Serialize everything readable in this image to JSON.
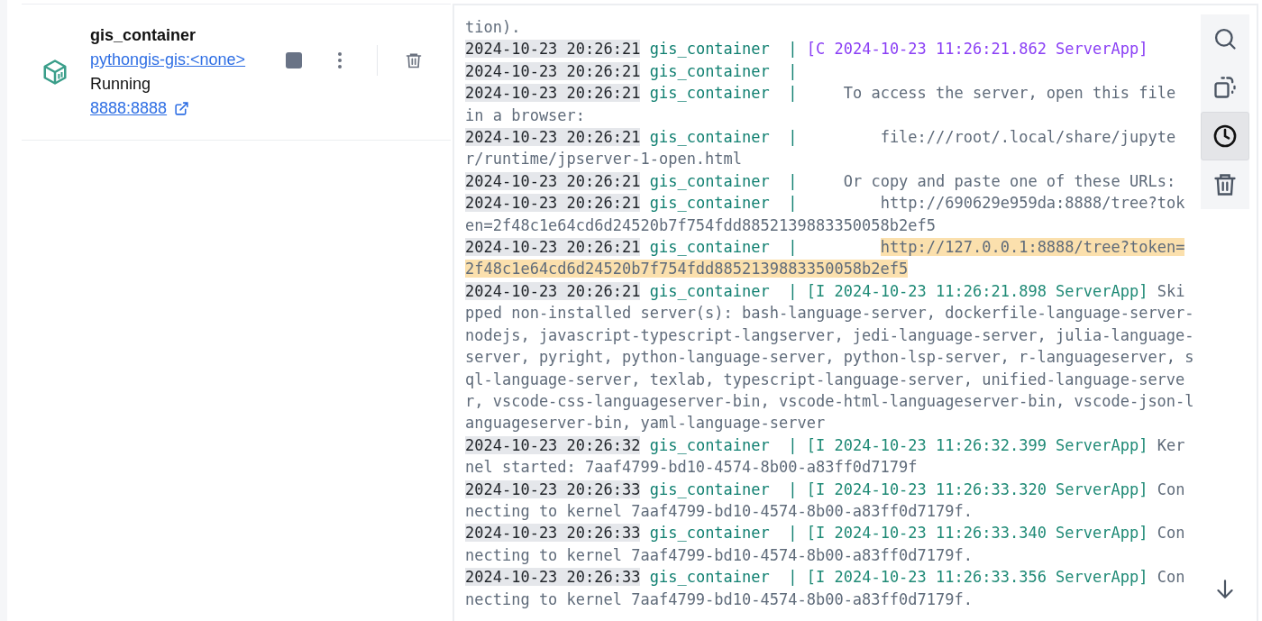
{
  "container": {
    "name": "gis_container",
    "image": "pythongis-gis:<none>",
    "status": "Running",
    "port": "8888:8888"
  },
  "log": {
    "fragment": "tion).",
    "entries": [
      {
        "timestamp": "2024-10-23 20:26:21",
        "container": "gis_container",
        "separator": "|",
        "prefix": "[C 2024-10-23 11:26:21.862 ServerApp]",
        "color": "#8a3ff5"
      },
      {
        "timestamp": "2024-10-23 20:26:21",
        "container": "gis_container",
        "separator": "|"
      },
      {
        "timestamp": "2024-10-23 20:26:21",
        "container": "gis_container",
        "separator": "|",
        "message": "    To access the server, open this file in a browser:"
      },
      {
        "timestamp": "2024-10-23 20:26:21",
        "container": "gis_container",
        "separator": "|",
        "message": "        file:///root/.local/share/jupyter/runtime/jpserver-1-open.html"
      },
      {
        "timestamp": "2024-10-23 20:26:21",
        "container": "gis_container",
        "separator": "|",
        "message": "    Or copy and paste one of these URLs:"
      },
      {
        "timestamp": "2024-10-23 20:26:21",
        "container": "gis_container",
        "separator": "|",
        "message": "        http://690629e959da:8888/tree?token=2f48c1e64cd6d24520b7f754fdd8852139883350058b2ef5"
      },
      {
        "timestamp": "2024-10-23 20:26:21",
        "container": "gis_container",
        "separator": "|",
        "highlight": "http://127.0.0.1:8888/tree?token=2f48c1e64cd6d24520b7f754fdd8852139883350058b2ef5"
      },
      {
        "timestamp": "2024-10-23 20:26:21",
        "container": "gis_container",
        "separator": "|",
        "prefix": "[I 2024-10-23 11:26:21.898 ServerApp]",
        "color": "#1f8a76",
        "message": " Skipped non-installed server(s): bash-language-server, dockerfile-language-server-nodejs, javascript-typescript-langserver, jedi-language-server, julia-language-server, pyright, python-language-server, python-lsp-server, r-languageserver, sql-language-server, texlab, typescript-language-server, unified-language-server, vscode-css-languageserver-bin, vscode-html-languageserver-bin, vscode-json-languageserver-bin, yaml-language-server"
      },
      {
        "timestamp": "2024-10-23 20:26:32",
        "container": "gis_container",
        "separator": "|",
        "prefix": "[I 2024-10-23 11:26:32.399 ServerApp]",
        "color": "#1f8a76",
        "message": " Kernel started: 7aaf4799-bd10-4574-8b00-a83ff0d7179f"
      },
      {
        "timestamp": "2024-10-23 20:26:33",
        "container": "gis_container",
        "separator": "|",
        "prefix": "[I 2024-10-23 11:26:33.320 ServerApp]",
        "color": "#1f8a76",
        "message": " Connecting to kernel 7aaf4799-bd10-4574-8b00-a83ff0d7179f."
      },
      {
        "timestamp": "2024-10-23 20:26:33",
        "container": "gis_container",
        "separator": "|",
        "prefix": "[I 2024-10-23 11:26:33.340 ServerApp]",
        "color": "#1f8a76",
        "message": " Connecting to kernel 7aaf4799-bd10-4574-8b00-a83ff0d7179f."
      },
      {
        "timestamp": "2024-10-23 20:26:33",
        "container": "gis_container",
        "separator": "|",
        "prefix": "[I 2024-10-23 11:26:33.356 ServerApp]",
        "color": "#1f8a76",
        "message": " Connecting to kernel 7aaf4799-bd10-4574-8b00-a83ff0d7179f."
      }
    ]
  },
  "toolbar": [
    {
      "kind": "search",
      "selected": false
    },
    {
      "kind": "copy",
      "selected": false
    },
    {
      "kind": "timestamps",
      "selected": true
    },
    {
      "kind": "clear",
      "selected": false
    }
  ]
}
